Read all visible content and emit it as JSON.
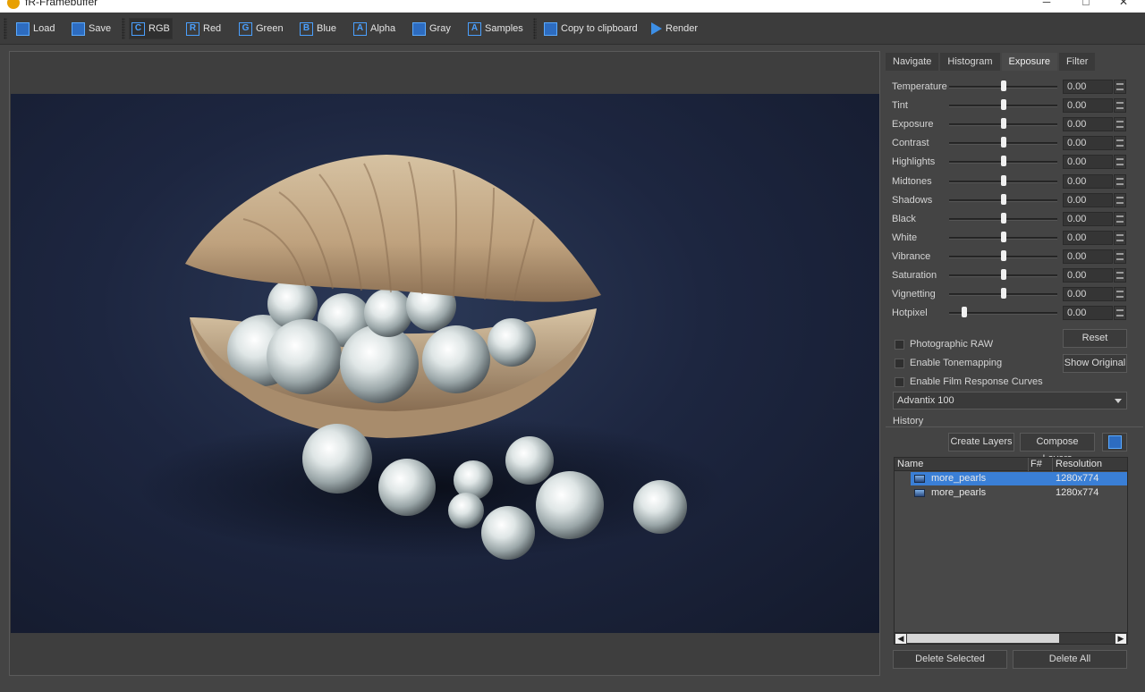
{
  "window": {
    "title": "fR-Framebuffer"
  },
  "toolbar": {
    "load": "Load",
    "save": "Save",
    "rgb": "RGB",
    "red": "Red",
    "green": "Green",
    "blue": "Blue",
    "alpha": "Alpha",
    "gray": "Gray",
    "samples": "Samples",
    "copy": "Copy to clipboard",
    "render": "Render"
  },
  "icons": {
    "load": "folder-open-icon",
    "save": "floppy-disk-icon",
    "copy": "clipboard-icon",
    "render": "play-icon"
  },
  "tabs": [
    "Navigate",
    "Histogram",
    "Exposure",
    "Filter"
  ],
  "active_tab": "Exposure",
  "exposure": {
    "sliders": [
      {
        "label": "Temperature",
        "value": "0.00",
        "position": 0.5
      },
      {
        "label": "Tint",
        "value": "0.00",
        "position": 0.5
      },
      {
        "label": "Exposure",
        "value": "0.00",
        "position": 0.5
      },
      {
        "label": "Contrast",
        "value": "0.00",
        "position": 0.5
      },
      {
        "label": "Highlights",
        "value": "0.00",
        "position": 0.5
      },
      {
        "label": "Midtones",
        "value": "0.00",
        "position": 0.5
      },
      {
        "label": "Shadows",
        "value": "0.00",
        "position": 0.5
      },
      {
        "label": "Black",
        "value": "0.00",
        "position": 0.5
      },
      {
        "label": "White",
        "value": "0.00",
        "position": 0.5
      },
      {
        "label": "Vibrance",
        "value": "0.00",
        "position": 0.5
      },
      {
        "label": "Saturation",
        "value": "0.00",
        "position": 0.5
      },
      {
        "label": "Vignetting",
        "value": "0.00",
        "position": 0.5
      },
      {
        "label": "Hotpixel",
        "value": "0.00",
        "position": 0.14
      }
    ],
    "photographic_raw": "Photographic RAW",
    "enable_tonemapping": "Enable Tonemapping",
    "enable_film_curves": "Enable Film Response Curves",
    "reset": "Reset",
    "show_original": "Show Original",
    "film": "Advantix 100"
  },
  "history": {
    "label": "History",
    "create_layers": "Create Layers",
    "compose_layers": "Compose Layers",
    "columns": {
      "name": "Name",
      "frame": "F#",
      "resolution": "Resolution"
    },
    "rows": [
      {
        "name": "more_pearls",
        "resolution": "1280x774"
      },
      {
        "name": "more_pearls",
        "resolution": "1280x774"
      }
    ],
    "delete_selected": "Delete Selected",
    "delete_all": "Delete All"
  },
  "colors": {
    "accent": "#3a7fd6",
    "icon_blue": "#4aa0ff",
    "background": "#444444"
  }
}
